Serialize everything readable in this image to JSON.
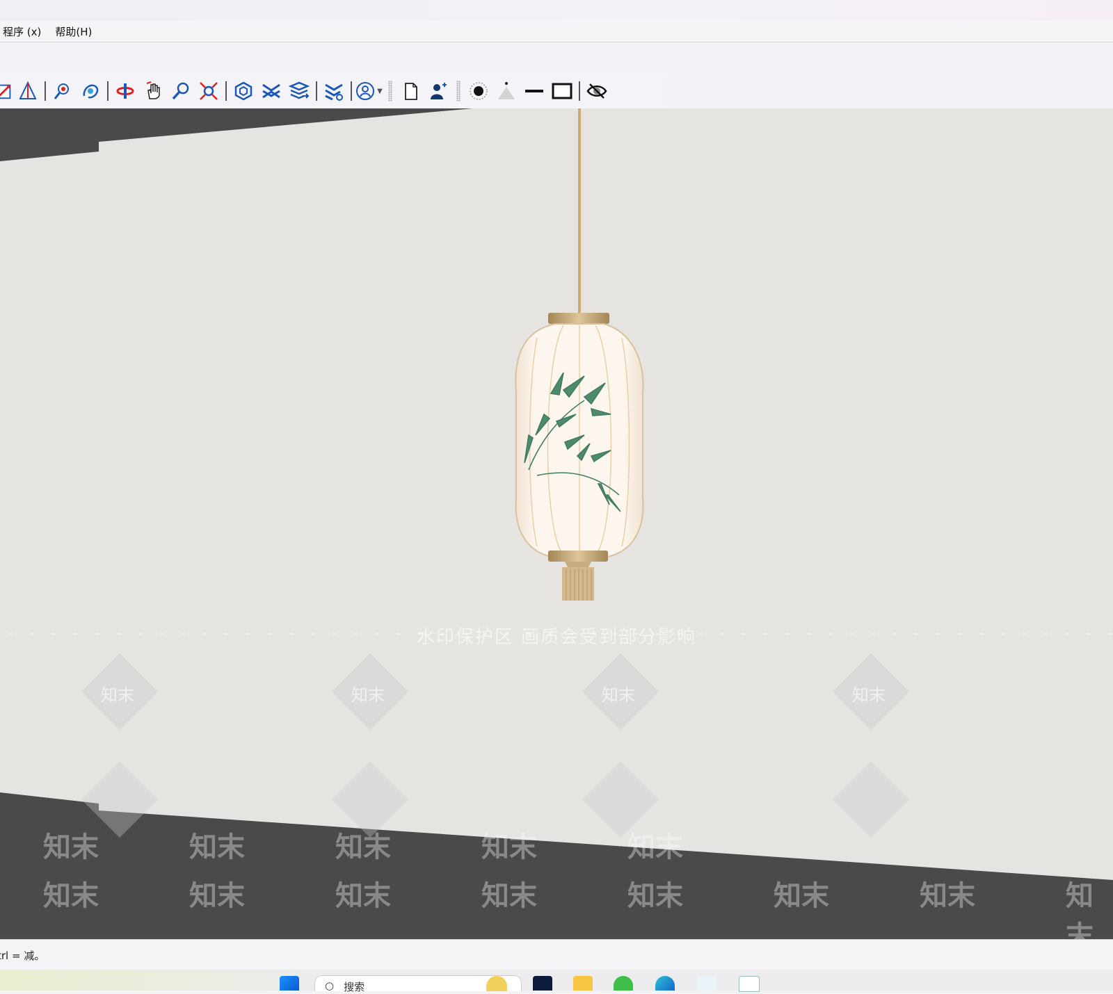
{
  "menu": {
    "items": [
      {
        "label": "程序 (x)"
      },
      {
        "label": "帮助(H)"
      }
    ]
  },
  "toolbar": {
    "tools": [
      "section-plane-icon",
      "axes-icon",
      "position-camera-icon",
      "look-around-icon",
      "orbit-icon",
      "pan-icon",
      "zoom-icon",
      "zoom-extents-icon",
      "warehouse-icon",
      "extension-warehouse-icon",
      "layers-send-icon",
      "extension-manager-icon",
      "account-icon",
      "new-file-icon",
      "add-user-icon",
      "point-icon",
      "cone-icon",
      "line-icon",
      "rectangle-icon",
      "hide-icon"
    ]
  },
  "viewport": {
    "watermark_notice": "水印保护区 画质会受到部分影响",
    "watermark_text": "知末",
    "background_color": "#e6e4e0",
    "floor_color": "#4b4a4a"
  },
  "status": {
    "hint": "trl = 减。"
  },
  "taskbar": {
    "search_placeholder": "搜索"
  }
}
